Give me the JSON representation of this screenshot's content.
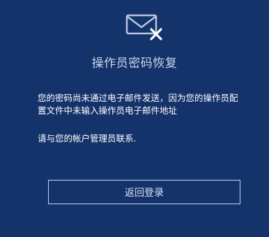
{
  "dialog": {
    "icon": "mail-error-icon",
    "title": "操作员密码恢复",
    "message_line1": "您的密码尚未通过电子邮件发送，因为您的操作员配",
    "message_line2": "置文件中未输入操作员电子邮件地址",
    "contact": "请与您的帐户管理员联系.",
    "return_button_label": "返回登录"
  },
  "colors": {
    "background": "#15336b",
    "title": "#c9d5ea",
    "icon": "#b9c6de",
    "button_border": "#c9d5ea"
  }
}
